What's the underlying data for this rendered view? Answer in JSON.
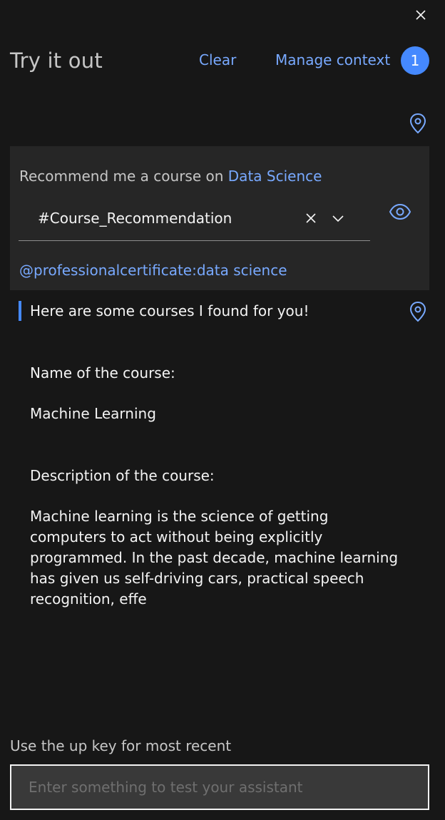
{
  "header": {
    "title": "Try it out",
    "clear_label": "Clear",
    "manage_context_label": "Manage context",
    "context_count": "1",
    "close_icon": "close-icon"
  },
  "conversation": {
    "user_message": {
      "text_prefix": "Recommend me a course on ",
      "highlight": "Data Science",
      "intent": "#Course_Recommendation",
      "entity": "@professionalcertificate:data science",
      "icons": [
        "location-pin-icon",
        "clear-icon",
        "chevron-down-icon",
        "eye-icon"
      ]
    },
    "bot_response": {
      "intro": "Here are some courses I found for you!",
      "name_label": "Name of the course:",
      "name_value": "Machine Learning",
      "description_label": "Description of the course:",
      "description_value": "Machine learning is the science of getting computers to act without being explicitly programmed. In the past decade, machine learning has given us self-driving cars, practical speech recognition, effe"
    }
  },
  "footer": {
    "hint": "Use the up key for most recent",
    "input_placeholder": "Enter something to test your assistant",
    "input_value": ""
  },
  "colors": {
    "background": "#171717",
    "card": "#262626",
    "accent": "#78a9ff",
    "badge": "#4589ff"
  }
}
